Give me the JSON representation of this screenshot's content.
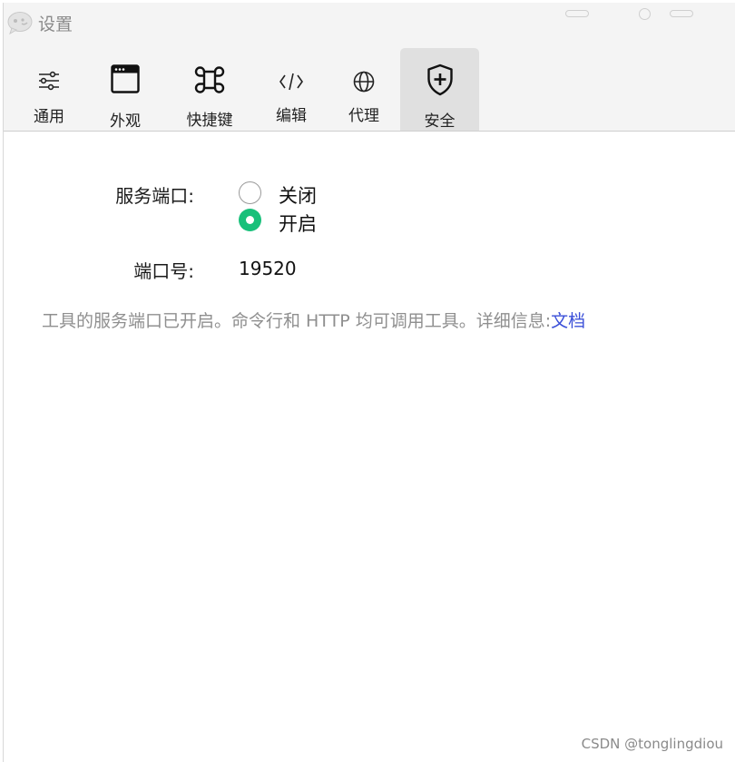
{
  "window": {
    "title": "设置",
    "icon": "chat-bubble-icon"
  },
  "tabs": [
    {
      "id": "general",
      "label": "通用",
      "icon": "sliders-icon",
      "active": false
    },
    {
      "id": "appearance",
      "label": "外观",
      "icon": "window-icon",
      "active": false
    },
    {
      "id": "shortcuts",
      "label": "快捷键",
      "icon": "command-key-icon",
      "active": false
    },
    {
      "id": "editor",
      "label": "编辑",
      "icon": "code-icon",
      "active": false
    },
    {
      "id": "proxy",
      "label": "代理",
      "icon": "globe-icon",
      "active": false
    },
    {
      "id": "security",
      "label": "安全",
      "icon": "shield-plus-icon",
      "active": true
    }
  ],
  "security": {
    "service_port_label": "服务端口:",
    "options": [
      {
        "label": "关闭",
        "selected": false
      },
      {
        "label": "开启",
        "selected": true
      }
    ],
    "port_number_label": "端口号:",
    "port_number_value": "19520",
    "info_text": "工具的服务端口已开启。命令行和 HTTP 均可调用工具。详细信息:",
    "doc_link": "文档"
  },
  "watermark": "CSDN @tonglingdiou",
  "colors": {
    "accent_green": "#18c07a",
    "link_blue": "#3a4fd8",
    "toolbar_bg": "#f4f4f4",
    "active_tab_bg": "#e0e0e0"
  }
}
